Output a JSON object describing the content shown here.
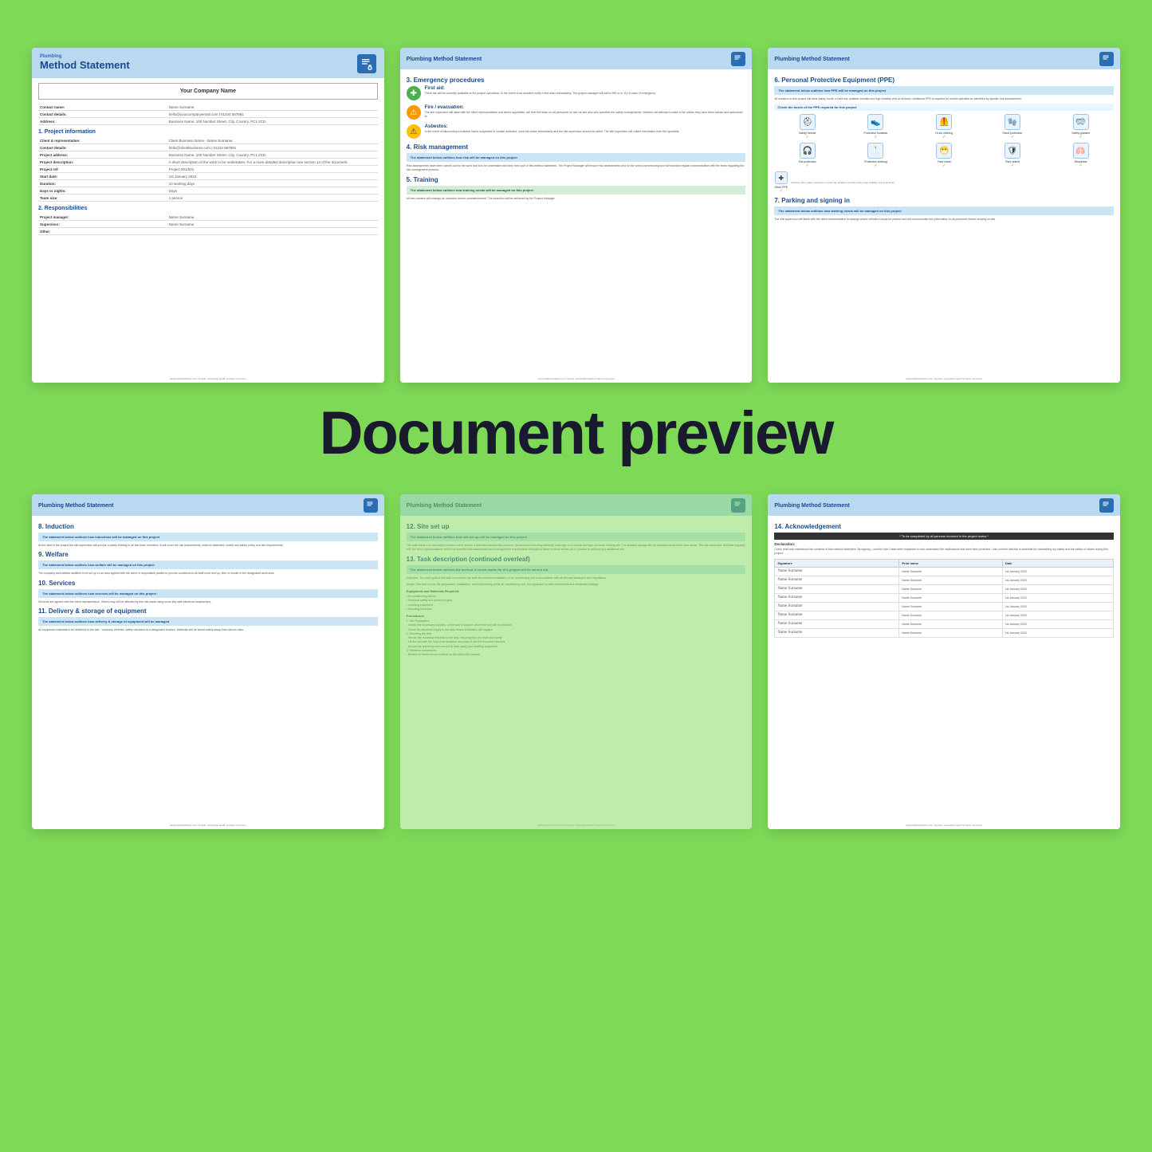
{
  "background_color": "#7ed957",
  "overlay_label": "Document preview",
  "page1": {
    "header_small": "Plumbing",
    "header_large": "Method Statement",
    "company_name": "Your Company Name",
    "contact_name_label": "Contact name:",
    "contact_name_value": "Name Surname",
    "contact_details_label": "Contact details:",
    "contact_details_value": "hello@yourcompanyemail.com  |  01234 567891",
    "address_label": "Address:",
    "address_value": "Business Name, 100 Number Street, City, Country, PC1 2CD",
    "section1_title": "1. Project information",
    "client_label": "Client & representative:",
    "client_value": "Client Business Name - Name Surname",
    "proj_contact_label": "Contact details:",
    "proj_contact_value": "hello@clientbusiness.com  |  01234 567891",
    "proj_address_label": "Project address:",
    "proj_address_value": "Business Name, 100 Number Street, City, Country, PC1 2CD",
    "proj_desc_label": "Project description:",
    "proj_desc_value": "A short description of the work to be undertaken. For a more detailed description see section 13 of the document.",
    "proj_ref_label": "Project ref:",
    "proj_ref_value": "Project 001/001",
    "start_date_label": "Start date:",
    "start_date_value": "1st January 2024",
    "duration_label": "Duration:",
    "duration_value": "10 working days",
    "days_nights_label": "Days or nights:",
    "days_nights_value": "Days",
    "team_size_label": "Team size:",
    "team_size_value": "1 person",
    "section2_title": "2. Responsibilities",
    "proj_manager_label": "Project manager:",
    "proj_manager_value": "Name Surname",
    "supervisor_label": "Supervisor:",
    "supervisor_value": "Name Surname",
    "other_label": "Other:",
    "other_value": ""
  },
  "page2": {
    "header": "Plumbing Method Statement",
    "section3_title": "3. Emergency procedures",
    "first_aid_title": "First aid:",
    "first_aid_text": "There are will be currently available to the project operations. In the event of an accident notify a first aider immediately. The project manager will call to 999 or to 112 in case of emergency.",
    "fire_evac_title": "Fire / evacuation:",
    "fire_evac_text": "The site supervisor will liaise with the client representatives and where applicable, will brief the team on all personnel on site via site also who specifies the safety arrangements. Workers will attempt to make a fire unless they have been trained and authorised to.",
    "asbestos_title": "Asbestos:",
    "asbestos_text": "In the event of discovering a material that is suspected to contain asbestos, work will cease immediately and the site supervisor should be called. The site supervisor will collect information from the specialist.",
    "section4_title": "4. Risk management",
    "risk_highlight": "The statement below outlines how risk will be managed on this project",
    "risk_text": "Risk assessments have been carried out for the work that is to be undertaken and they form part of this method statement. The Project Manager will ensure risk assessments prior to the works commencing and will maintain regular communication with the team regarding the risk management process.",
    "section5_title": "5. Training",
    "training_highlight": "The statement below outlines how training needs will be managed on this project",
    "training_text": "All new starters will undergo an induction before commencement. The induction will be delivered by the Project Manager."
  },
  "page3": {
    "header": "Plumbing Method Statement",
    "section6_title": "6. Personal Protective Equipment (PPE)",
    "ppe_highlight": "The statement below outlines how PPE will be managed on this project",
    "ppe_desc": "All workers on this project will wear safety boots, a hard hat, suitable overalls and high visibility vest at all times. Additional PPE is required for certain activities as identified by specific risk assessments.",
    "ppe_check_title": "Check the boxes of the PPE required for this project",
    "ppe_items": [
      {
        "name": "Safety helmet",
        "icon": "⛑",
        "checked": true
      },
      {
        "name": "Protective footwear",
        "icon": "👟",
        "checked": true
      },
      {
        "name": "Hi-vis clothing",
        "icon": "🦺",
        "checked": true
      },
      {
        "name": "Hand protection",
        "icon": "🧤",
        "checked": true
      },
      {
        "name": "Safety glasses",
        "icon": "🥽",
        "checked": true
      },
      {
        "name": "Ear protection",
        "icon": "🎧",
        "checked": true
      },
      {
        "name": "Protective clothing",
        "icon": "🥼",
        "checked": true
      },
      {
        "name": "Face mask",
        "icon": "😷",
        "checked": true
      },
      {
        "name": "Face shield",
        "icon": "🛡",
        "checked": true
      },
      {
        "name": "Respirator",
        "icon": "🫁",
        "checked": true
      },
      {
        "name": "Other PPE",
        "icon": "✚",
        "checked": true
      }
    ],
    "section7_title": "7. Parking and signing in",
    "parking_highlight": "The statement below outlines how training needs will be managed on this project",
    "parking_text": "The site supervisor will liaise with the client representative to arrange where vehicles should be parked and will communicate this information to all personnel before arriving on site."
  },
  "page4": {
    "header": "Plumbing Method Statement",
    "section8_title": "8. Induction",
    "induction_highlight": "The statement below outlines how inductions will be managed on this project",
    "induction_text": "At the start of the project the site supervisor will provide a safety briefing to all site team members. It will cover the risk assessments, method statement, health and safety policy and site requirements.",
    "section9_title": "9. Welfare",
    "welfare_highlight": "The statement below outlines how welfare will be managed on this project",
    "welfare_text": "The company and welfare facilities to be set up or an area agreed with the client or responsible parties to provide conditions to all staff must rest up, dine or smoke in the designated work area.",
    "section10_title": "10. Services",
    "services_highlight": "The statement below outlines how services will be managed on this project",
    "services_text": "Services are agreed with the client representative. Others may will be affected by this risk made using some key safe electrical transformers.",
    "section11_title": "11. Delivery & storage of equipment",
    "delivery_highlight": "The statement below outlines how delivery & storage of equipment will be managed",
    "delivery_text": "All equipment materials to be delivered to the site - company vehicles, safely unloaded at a designated location. Materials will be stored safely away from various risks."
  },
  "page5": {
    "header": "Plumbing Method Statement",
    "section12_title": "12. Site set up",
    "setup_highlight": "The statement below outlines how site set up will be managed on this project",
    "setup_text": "The main issue is to accurately construct all to ensure a specified construction process. All personnel including statutory must sign in on arrival and sign out when leaving site. The suitable signage will be displayed around the work areas. The site supervisor will liaise regularly with the client representatives within the identified risk assessment and management requirements throughout these workers will be put in practice to address any additional risk.",
    "section13_title": "13. Task description (continued overleaf)",
    "task_highlight": "The statement below outlines the method in which works for this project will be carried out",
    "task_text": "Objective: The main goal of this task is to ensure the safe and efficient installation of air conditioning unit in accordance with all relevant standards and regulations.",
    "task_scope": "Scope: This task covers the preparation, installation, and initial testing of the air conditioning unit. It is applicable to both commercial and residential settings.",
    "equipment_list": "Equipment and Materials Required",
    "procedures": "Procedures"
  },
  "page6": {
    "header": "Plumbing Method Statement",
    "section14_title": "14. Acknowledgement",
    "declaration_header": "* To be completed by all persons involved in the project works *",
    "declaration_title": "Declaration:",
    "declaration_text": "I have read and understood the contents of this method statement. By signing, I confirm that I have been explained to and understand the implications that have been provided. I can confirm that this is essential for maintaining my safety and the safety of others during this project.",
    "sig_col_signature": "Signature",
    "sig_col_print": "Print name",
    "sig_col_date": "Date",
    "signatures": [
      {
        "sig": "Name Surname",
        "print": "Name Surname",
        "date": "1st January 2024"
      },
      {
        "sig": "Name Surname",
        "print": "Name Surname",
        "date": "1st January 2024"
      },
      {
        "sig": "Name Surname",
        "print": "Name Surname",
        "date": "1st January 2024"
      },
      {
        "sig": "Name Surname",
        "print": "Name Surname",
        "date": "1st January 2024"
      },
      {
        "sig": "Name Surname",
        "print": "Name Surname",
        "date": "1st January 2024"
      },
      {
        "sig": "Name Surname",
        "print": "Name Surname",
        "date": "1st January 2024"
      },
      {
        "sig": "Name Surname",
        "print": "Name Surname",
        "date": "1st January 2024"
      },
      {
        "sig": "Name Surname",
        "print": "Name Surname",
        "date": "1st January 2024"
      }
    ]
  },
  "footer_text": "easyhealthandsafety.com | Simple, accessible health & safety resources"
}
